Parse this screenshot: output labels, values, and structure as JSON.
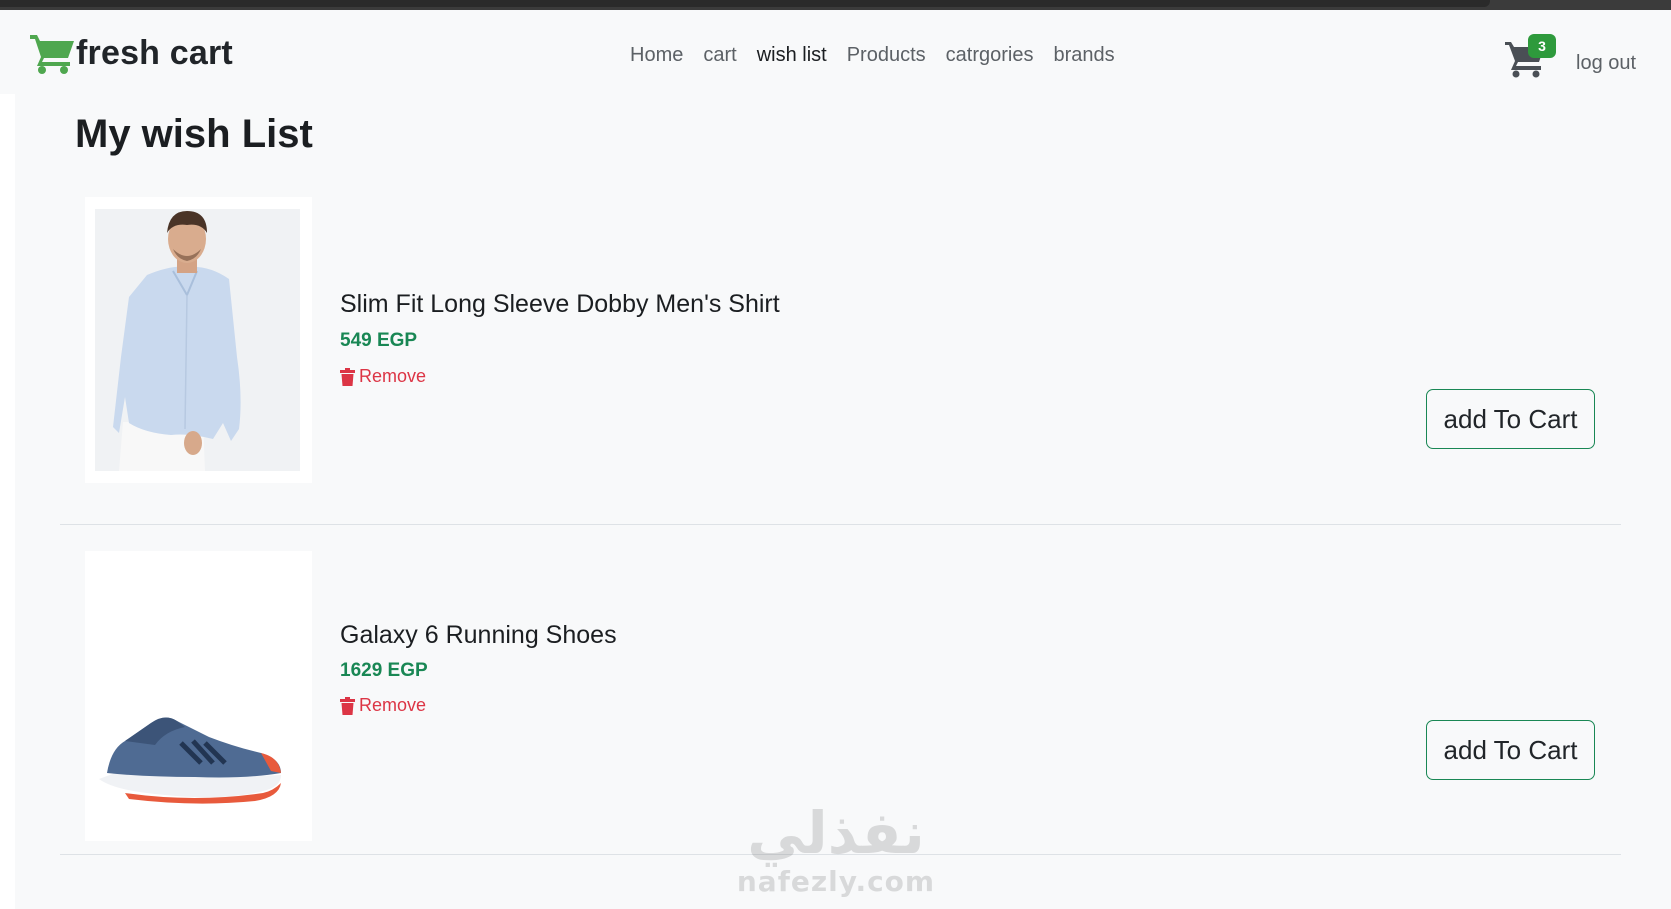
{
  "navbar": {
    "brand": "fresh cart",
    "links": [
      {
        "label": "Home"
      },
      {
        "label": "cart"
      },
      {
        "label": "wish list"
      },
      {
        "label": "Products"
      },
      {
        "label": "catrgories"
      },
      {
        "label": "brands"
      }
    ],
    "active_link": "wish list",
    "cart_count": "3",
    "logout": "log out"
  },
  "page": {
    "title": "My wish List"
  },
  "wishlist": {
    "items": [
      {
        "name": "Slim Fit Long Sleeve Dobby Men's Shirt",
        "price": "549 EGP",
        "remove_label": "Remove",
        "add_label": "add To Cart",
        "image": "mens-shirt-photo"
      },
      {
        "name": "Galaxy 6 Running Shoes",
        "price": "1629 EGP",
        "remove_label": "Remove",
        "add_label": "add To Cart",
        "image": "running-shoe-photo"
      }
    ]
  },
  "watermark": {
    "arabic": "نفذلي",
    "latin": "nafezly.com"
  },
  "colors": {
    "brand_green": "#4fa74f",
    "price_green": "#198754",
    "remove_red": "#dc3545",
    "badge_green": "#2e9a3c"
  }
}
